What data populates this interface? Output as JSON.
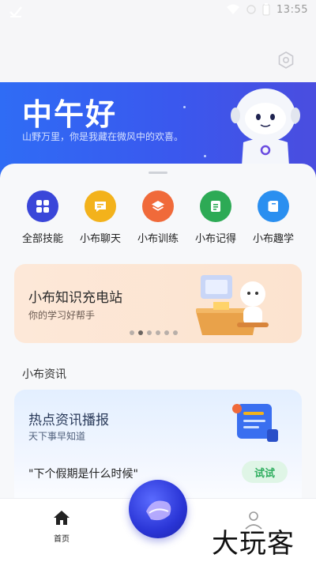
{
  "status_bar": {
    "time": "13:55"
  },
  "hero": {
    "title": "中午好",
    "subtitle": "山野万里，你是我藏在微风中的欢喜。"
  },
  "skills": [
    {
      "label": "全部技能",
      "color": "#3a46d9",
      "icon": "grid-icon"
    },
    {
      "label": "小布聊天",
      "color": "#f3b21b",
      "icon": "chat-icon"
    },
    {
      "label": "小布训练",
      "color": "#f06a3a",
      "icon": "layers-icon"
    },
    {
      "label": "小布记得",
      "color": "#2daa55",
      "icon": "notes-icon"
    },
    {
      "label": "小布趣学",
      "color": "#2a8ff0",
      "icon": "book-icon"
    }
  ],
  "banner": {
    "title": "小布知识充电站",
    "subtitle": "你的学习好帮手",
    "page_count": 6,
    "active_page": 2
  },
  "news": {
    "section_title": "小布资讯",
    "title": "热点资讯播报",
    "subtitle": "天下事早知道",
    "query": "\"下个假期是什么时候\"",
    "try_label": "试试"
  },
  "nav": {
    "home_label": "首页"
  },
  "watermark": "大玩客",
  "colors": {
    "hero_start": "#2f6cf5",
    "hero_end": "#4a4ddf",
    "try_text": "#2fae5f",
    "try_bg": "#dff5e6"
  }
}
